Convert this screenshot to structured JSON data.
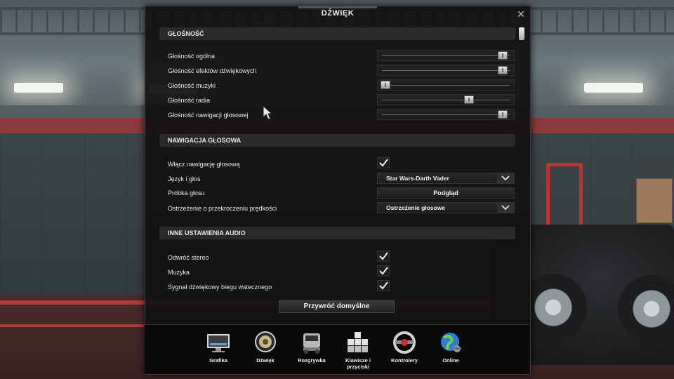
{
  "dialog": {
    "title": "DŹWIĘK",
    "close_label": "✕"
  },
  "sections": {
    "volume": {
      "header": "GŁOŚNOŚĆ",
      "rows": [
        {
          "label": "Głośność ogólna",
          "value": 0.97
        },
        {
          "label": "Głośność efektów dźwiękowych",
          "value": 0.97
        },
        {
          "label": "Głośność muzyki",
          "value": 0.0
        },
        {
          "label": "Głośność radia",
          "value": 0.69
        },
        {
          "label": "Głośność nawigacji głosowej",
          "value": 0.97
        }
      ]
    },
    "voice_nav": {
      "header": "NAWIGACJA GŁOSOWA",
      "enable_label": "Włącz nawigację głosową",
      "enable_checked": true,
      "language_label": "Język i głos",
      "language_value": "Star Wars-Darth Vader",
      "sample_label": "Próbka głosu",
      "preview_button": "Podgląd",
      "speed_warning_label": "Ostrzeżenie o przekroczeniu prędkości",
      "speed_warning_value": "Ostrzeżenie głosowe"
    },
    "other_audio": {
      "header": "INNE USTAWIENIA AUDIO",
      "rows": [
        {
          "label": "Odwróć stereo",
          "checked": true
        },
        {
          "label": "Muzyka",
          "checked": true
        },
        {
          "label": "Sygnał dźwiękowy biegu wstecznego",
          "checked": true
        }
      ]
    }
  },
  "reset_button": "Przywróć domyślne",
  "nav": {
    "items": [
      {
        "label": "Grafika",
        "icon": "monitor-icon"
      },
      {
        "label": "Dźwięk",
        "icon": "speaker-icon"
      },
      {
        "label": "Rozgrywka",
        "icon": "truck-icon"
      },
      {
        "label": "Klawisze i przyciski",
        "icon": "keyboard-keys-icon"
      },
      {
        "label": "Kontrolery",
        "icon": "steering-wheel-icon"
      },
      {
        "label": "Online",
        "icon": "globe-icon"
      }
    ]
  },
  "colors": {
    "panel": "#121213",
    "section_header": "#2a2a2b",
    "accent_red": "#b23a3a"
  }
}
